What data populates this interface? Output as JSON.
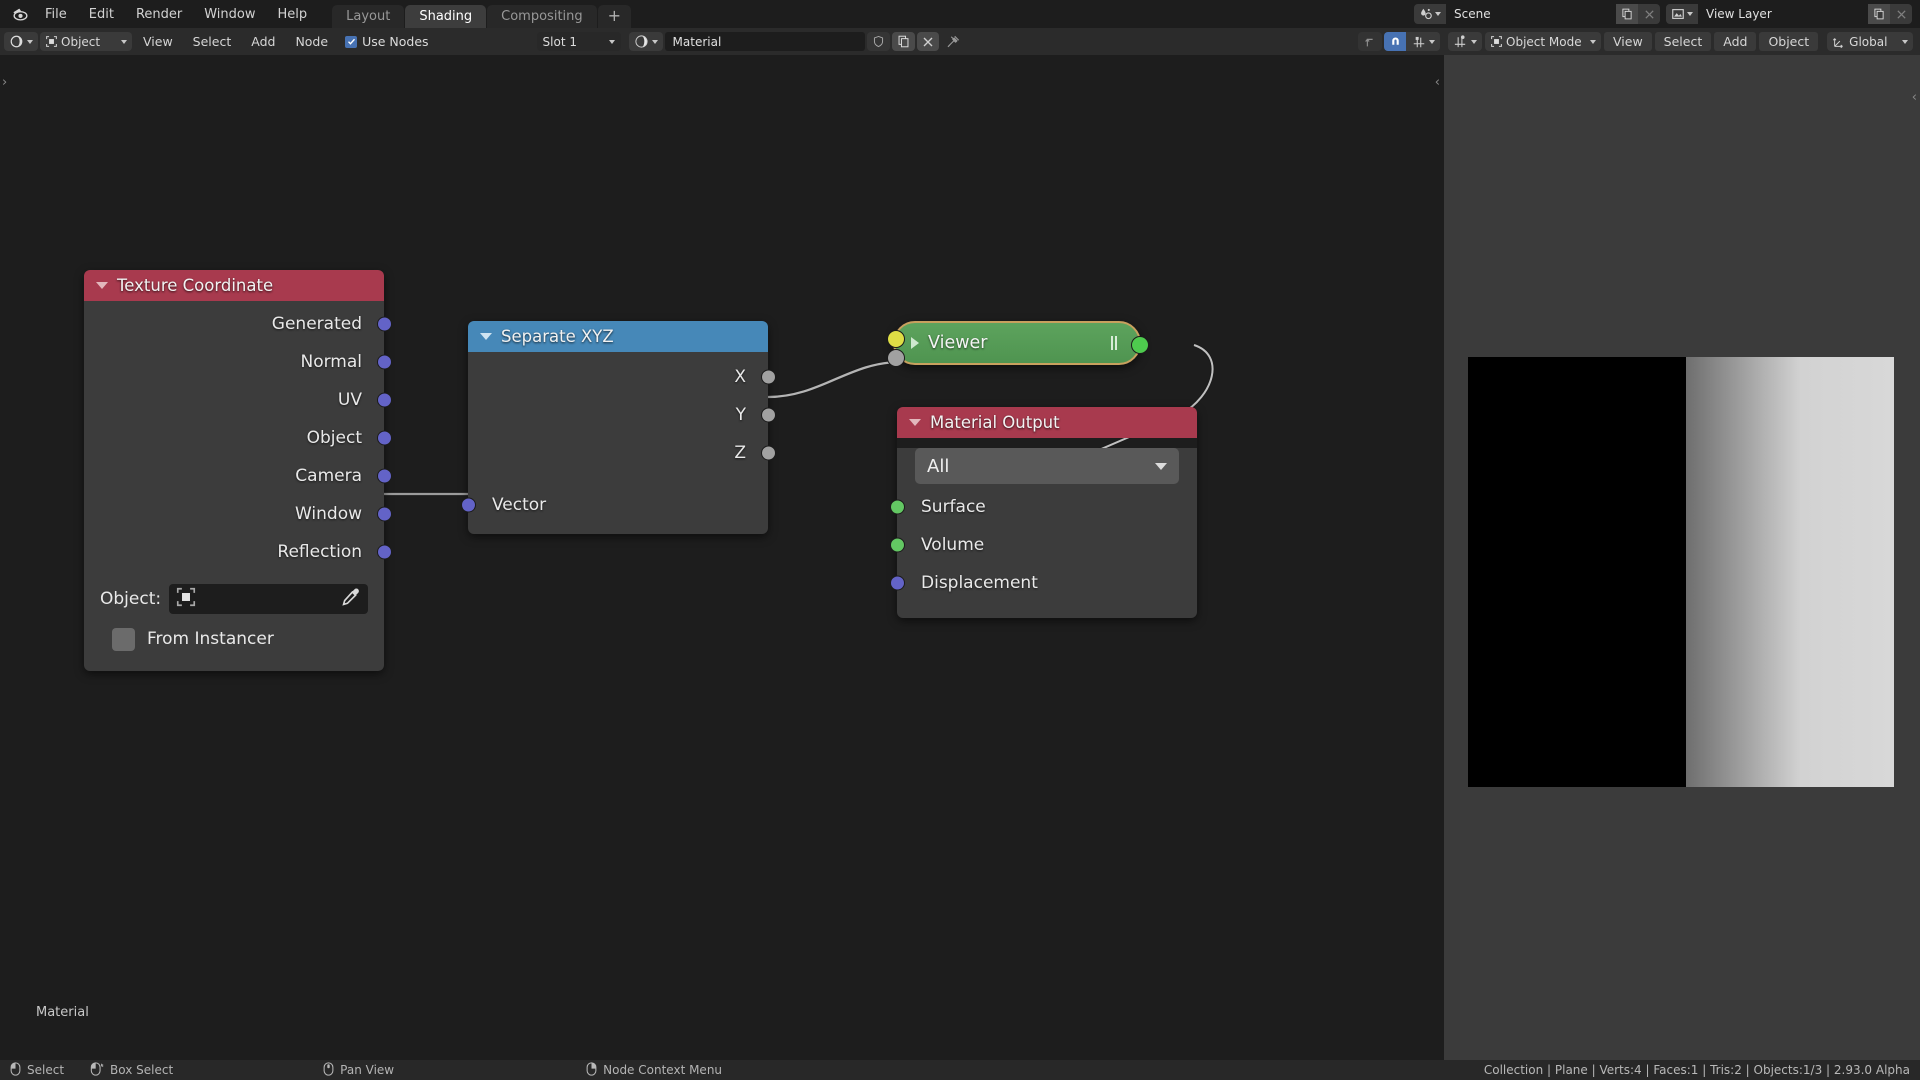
{
  "topbar": {
    "logo_icon": "blender-logo-icon",
    "menus": [
      "File",
      "Edit",
      "Render",
      "Window",
      "Help"
    ],
    "workspaces": [
      {
        "label": "Layout",
        "active": false
      },
      {
        "label": "Shading",
        "active": true
      },
      {
        "label": "Compositing",
        "active": false
      }
    ],
    "add_workspace_label": "+",
    "scene": {
      "icon": "scene-icon",
      "value": "Scene",
      "new_icon": "duplicate-icon",
      "delete_icon": "close-icon"
    },
    "view_layer": {
      "icon": "view-layer-icon",
      "value": "View Layer",
      "new_icon": "duplicate-icon",
      "delete_icon": "close-icon"
    }
  },
  "node_editor_header": {
    "editor_type_icon": "shader-editor-icon",
    "shader_type": "Object",
    "shader_type_icon": "object-icon",
    "menus": [
      "View",
      "Select",
      "Add",
      "Node"
    ],
    "use_nodes_label": "Use Nodes",
    "use_nodes_checked": true,
    "slot": "Slot 1",
    "material_icon": "material-sphere-icon",
    "material_name": "Material",
    "shield_icon": "fake-user-icon",
    "copy_icon": "new-material-icon",
    "unlink_icon": "unlink-icon",
    "pin_icon": "pin-icon",
    "snap_parent_icon": "go-to-parent-icon",
    "snap_magnet_icon": "snap-magnet-icon",
    "snap_target_icon": "snap-target-icon",
    "snap_target_caret": "chevron-down-icon"
  },
  "node_editor": {
    "footer_label": "Material",
    "collapse_left_icon": "chevron-right-icon",
    "collapse_right_icon": "chevron-left-icon"
  },
  "nodes": {
    "texture_coordinate": {
      "title": "Texture Coordinate",
      "header_color": "#a83a4e",
      "collapse_icon": "triangle-down-icon",
      "outputs": [
        "Generated",
        "Normal",
        "UV",
        "Object",
        "Camera",
        "Window",
        "Reflection"
      ],
      "object_prop_label": "Object:",
      "object_prop_icon": "object-select-icon",
      "eyedropper_icon": "eyedropper-icon",
      "from_instancer_label": "From Instancer",
      "from_instancer_checked": false
    },
    "separate_xyz": {
      "title": "Separate XYZ",
      "header_color": "#4688b8",
      "collapse_icon": "triangle-down-icon",
      "outputs": [
        "X",
        "Y",
        "Z"
      ],
      "inputs": [
        "Vector"
      ]
    },
    "viewer": {
      "title": "Viewer",
      "header_color": "#559455",
      "expand_icon": "triangle-right-icon",
      "pause_icon": "pause-icon",
      "selected": true
    },
    "material_output": {
      "title": "Material Output",
      "header_color": "#a83a4e",
      "collapse_icon": "triangle-down-icon",
      "target_value": "All",
      "target_caret": "chevron-down-icon",
      "inputs": [
        "Surface",
        "Volume",
        "Displacement"
      ]
    }
  },
  "viewport_header": {
    "editor_icon": "3d-viewport-icon",
    "mode_icon": "object-icon",
    "mode": "Object Mode",
    "menus": [
      "View",
      "Select",
      "Add",
      "Object"
    ],
    "orientation_icon": "transform-orientation-icon",
    "orientation": "Global",
    "orientation_caret": "chevron-down-icon"
  },
  "statusbar": {
    "hints": [
      {
        "icon": "mouse-left-icon",
        "label": "Select"
      },
      {
        "icon": "mouse-left-drag-icon",
        "label": "Box Select"
      },
      {
        "icon": "mouse-middle-icon",
        "label": "Pan View"
      },
      {
        "icon": "mouse-right-icon",
        "label": "Node Context Menu"
      }
    ],
    "scene_stats": "Collection | Plane | Verts:4 | Faces:1 | Tris:2 | Objects:1/3 | 2.93.0 Alpha"
  }
}
